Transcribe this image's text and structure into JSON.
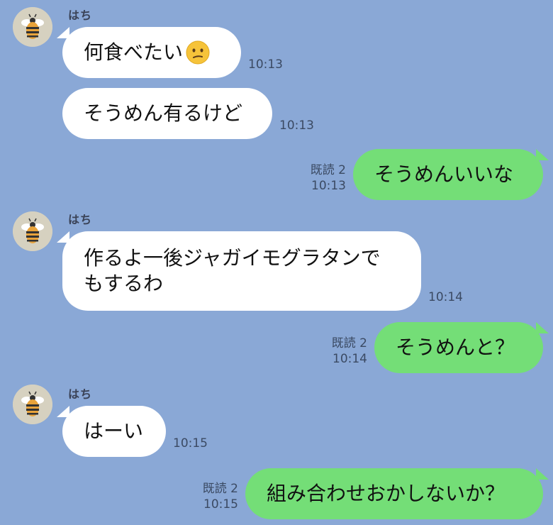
{
  "chat": {
    "messages": [
      {
        "sender": "はち",
        "text": "何食べたい",
        "emoji": "confused-face-icon",
        "time": "10:13"
      },
      {
        "text": "そうめん有るけど",
        "time": "10:13"
      },
      {
        "text": "そうめんいいな",
        "read": "既読 2",
        "time": "10:13"
      },
      {
        "sender": "はち",
        "line1": "作るよ一後ジャガイモグラタンで",
        "line2": "もするわ",
        "time": "10:14"
      },
      {
        "text": "そうめんと？",
        "read": "既読 2",
        "time": "10:14"
      },
      {
        "sender": "はち",
        "text": "はーい",
        "time": "10:15"
      },
      {
        "text": "組み合わせおかしないか？",
        "read": "既読 2",
        "time": "10:15"
      }
    ]
  },
  "colors": {
    "background": "#8aa8d6",
    "incoming_bubble": "#ffffff",
    "outgoing_bubble": "#74de77"
  }
}
